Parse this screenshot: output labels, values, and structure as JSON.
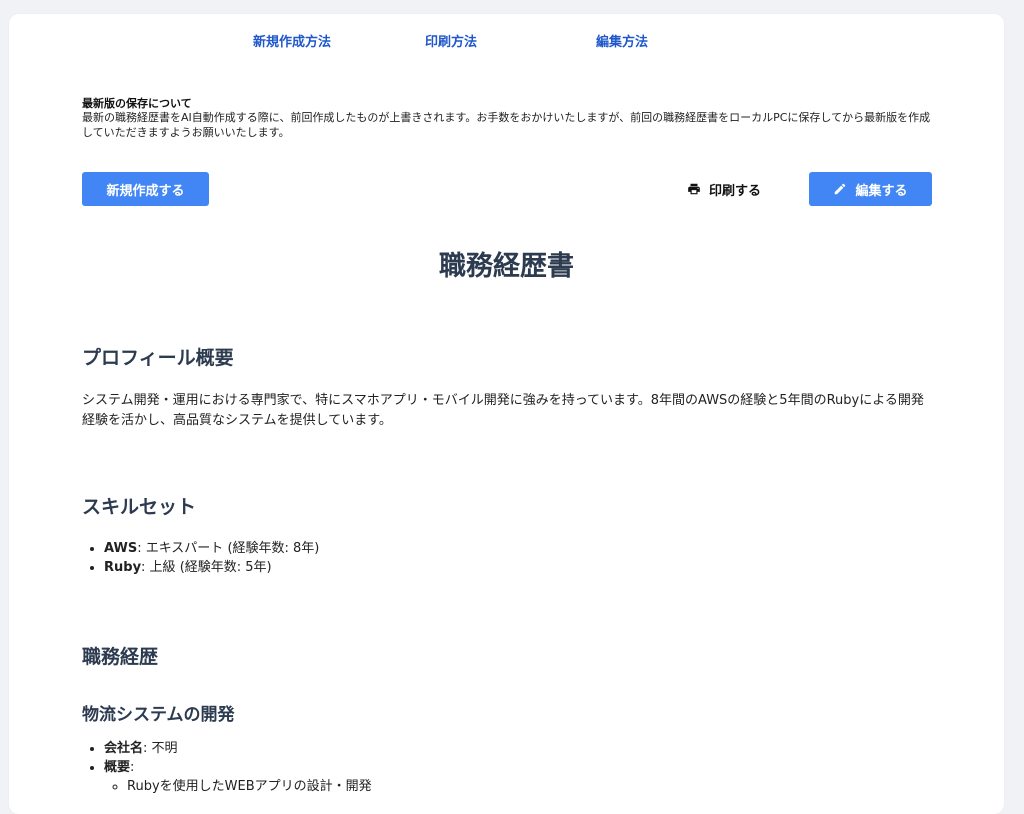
{
  "nav": {
    "links": [
      "新規作成方法",
      "印刷方法",
      "編集方法"
    ]
  },
  "notice": {
    "title": "最新版の保存について",
    "body": "最新の職務経歴書をAI自動作成する際に、前回作成したものが上書きされます。お手数をおかけいたしますが、前回の職務経歴書をローカルPCに保存してから最新版を作成していただきますようお願いいたします。"
  },
  "actions": {
    "create_label": "新規作成する",
    "print_label": "印刷する",
    "edit_label": "編集する"
  },
  "document": {
    "title": "職務経歴書",
    "profile": {
      "heading": "プロフィール概要",
      "text": "システム開発・運用における専門家で、特にスマホアプリ・モバイル開発に強みを持っています。8年間のAWSの経験と5年間のRubyによる開発経験を活かし、高品質なシステムを提供しています。"
    },
    "skills": {
      "heading": "スキルセット",
      "items": [
        {
          "name": "AWS",
          "detail": ": エキスパート (経験年数: 8年)"
        },
        {
          "name": "Ruby",
          "detail": ": 上級 (経験年数: 5年)"
        }
      ]
    },
    "career": {
      "heading": "職務経歴",
      "project": {
        "title": "物流システムの開発",
        "company_label": "会社名",
        "company_value": ": 不明",
        "summary_label": "概要",
        "summary_colon": ":",
        "summary_items": [
          "Rubyを使用したWEBアプリの設計・開発"
        ]
      }
    }
  },
  "colors": {
    "accent": "#4286f5",
    "link": "#1f57cc",
    "heading": "#2c3b4f",
    "background": "#f1f2f6"
  },
  "icons": {
    "print": "printer-icon",
    "edit": "pencil-icon"
  }
}
